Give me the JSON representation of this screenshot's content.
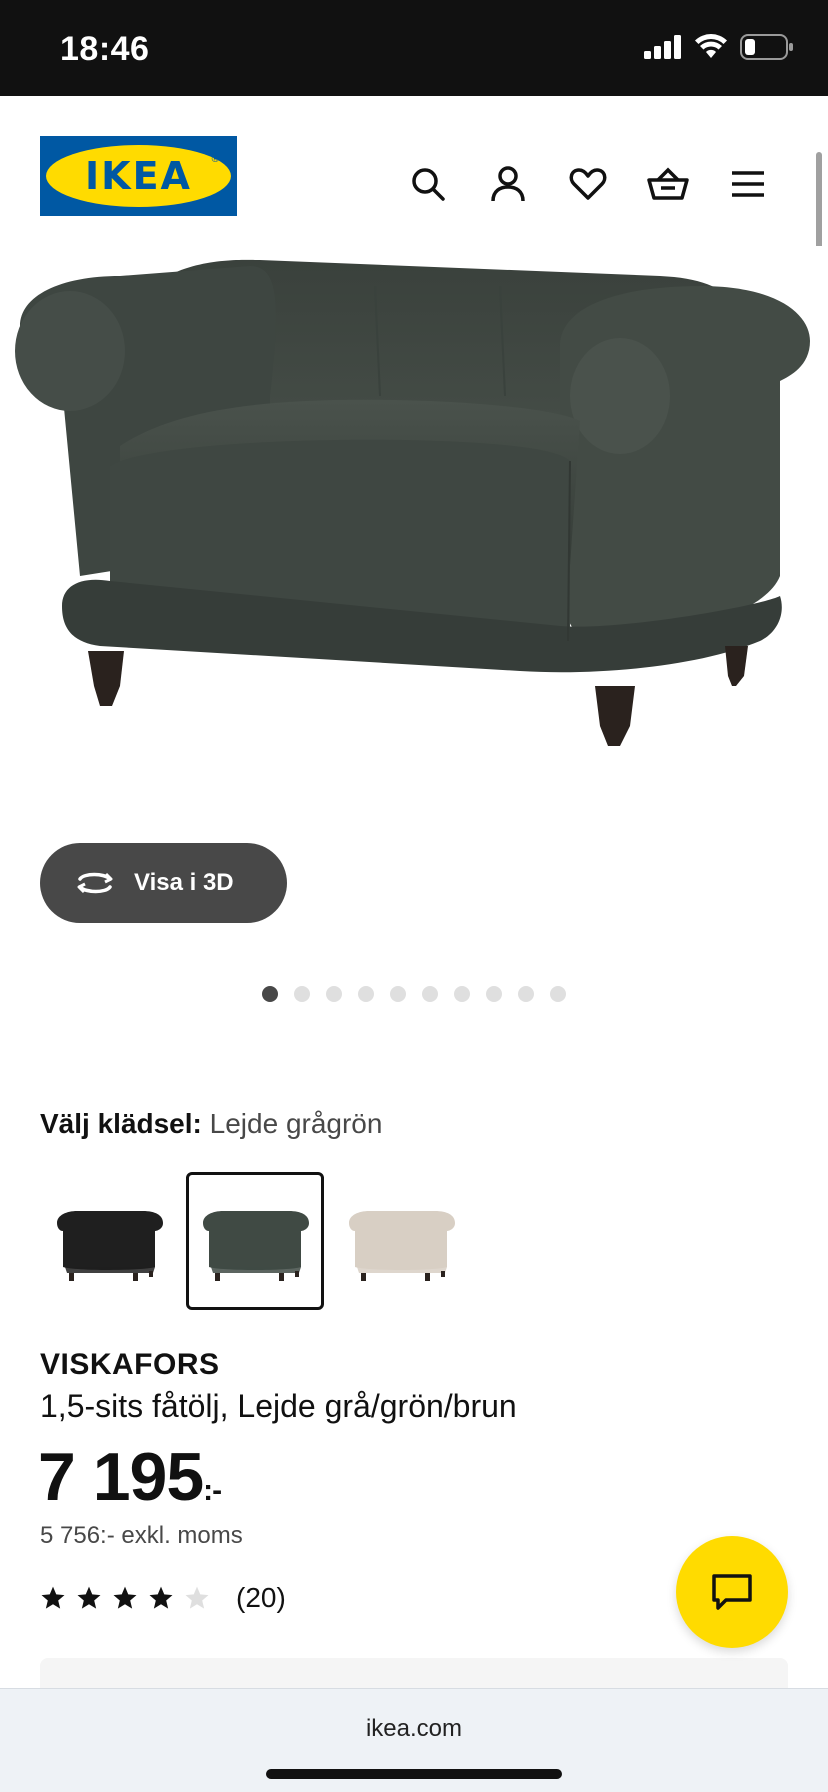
{
  "status_bar": {
    "time": "18:46"
  },
  "brand": {
    "logo_text": "IKEA",
    "registered": "®",
    "blue": "#0058a3",
    "yellow": "#ffdb00"
  },
  "nav": {
    "icons": [
      "search-icon",
      "account-icon",
      "favourites-icon",
      "basket-icon",
      "menu-icon"
    ]
  },
  "hero": {
    "sofa_color": "#3e4640",
    "legs_color": "#2a221e"
  },
  "view_3d": {
    "label": "Visa i 3D"
  },
  "carousel": {
    "count": 10,
    "active_index": 0
  },
  "upholstery": {
    "label": "Välj klädsel:",
    "value": "Lejde grågrön",
    "options": [
      {
        "color": "#1f1f1f",
        "selected": false
      },
      {
        "color": "#404a44",
        "selected": true
      },
      {
        "color": "#d8cfc4",
        "selected": false
      }
    ]
  },
  "product": {
    "name": "VISKAFORS",
    "description": "1,5-sits fåtölj, Lejde grå/grön/brun",
    "price_main": "7 195",
    "price_suffix": ":-",
    "price_excl_vat": "5 756:- exkl. moms",
    "rating_value": 4,
    "rating_max": 5,
    "rating_count": "(20)"
  },
  "browser": {
    "url": "ikea.com"
  }
}
